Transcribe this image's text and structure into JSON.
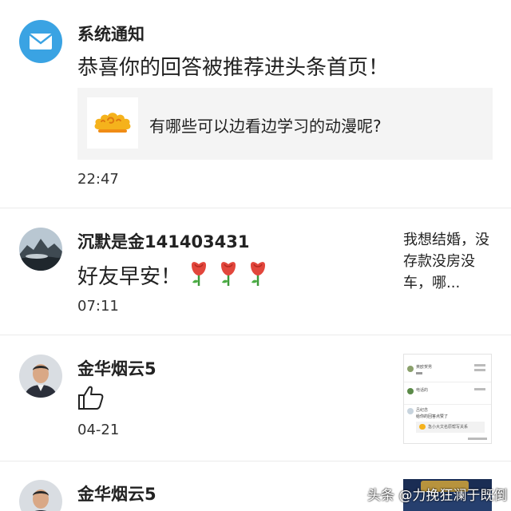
{
  "notifications": [
    {
      "sender": "系统通知",
      "message": "恭喜你的回答被推荐进头条首页！",
      "card_text": "有哪些可以边看边学习的动漫呢?",
      "time": "22:47"
    },
    {
      "sender": "沉默是金141403431",
      "message": "好友早安！",
      "time": "07:11",
      "preview_text": "我想结婚，没存款没房没车，哪..."
    },
    {
      "sender": "金华烟云5",
      "time": "04-21",
      "preview_lines": [
        "黄欧贺男",
        "电话的",
        "吕纪念",
        "给你的回答点赞了",
        "急小大文名原帮写关系"
      ]
    },
    {
      "sender": "金华烟云5"
    }
  ],
  "watermark": "头条 @力挽狂澜于既倒",
  "colors": {
    "system_icon_bg": "#3aa3e3",
    "card_bg": "#f4f4f4",
    "divider": "#ebebeb",
    "rose": "#e2463c"
  },
  "icons": [
    "mail-icon",
    "auspicious-cloud-icon",
    "rose-emoji-icon",
    "thumbs-up-icon"
  ]
}
